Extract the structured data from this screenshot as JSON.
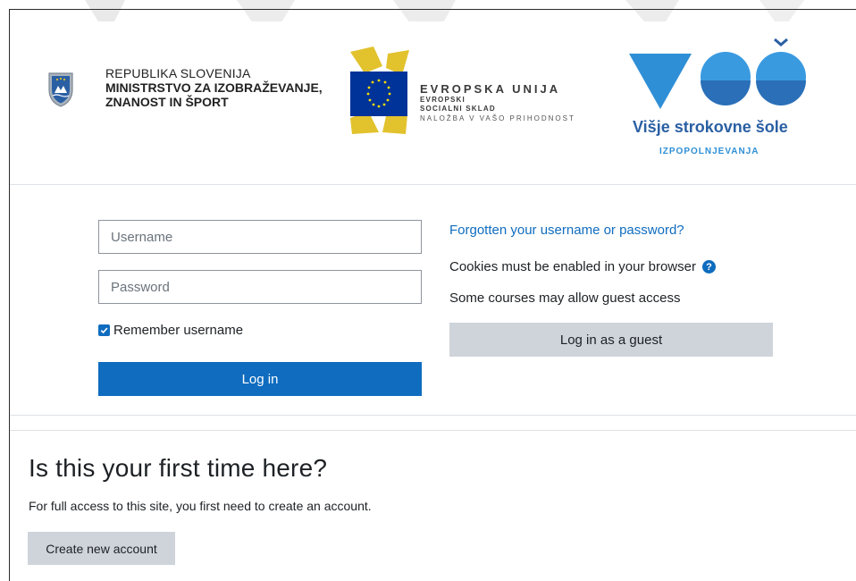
{
  "banner": {
    "slovenia": {
      "line1": "REPUBLIKA SLOVENIJA",
      "line2": "MINISTRSTVO ZA IZOBRAŽEVANJE,",
      "line3": "ZNANOST IN ŠPORT"
    },
    "eu": {
      "line1": "EVROPSKA UNIJA",
      "line2": "EVROPSKI",
      "line3": "SOCIALNI SKLAD",
      "line4": "NALOŽBA V VAŠO PRIHODNOST"
    },
    "voe": {
      "title": "Višje strokovne šole",
      "subtitle": "IZPOPOLNJEVANJA"
    }
  },
  "login": {
    "username_placeholder": "Username",
    "password_placeholder": "Password",
    "remember_label": "Remember username",
    "remember_checked": true,
    "login_button": "Log in",
    "forgot_link": "Forgotten your username or password?",
    "cookies_text": "Cookies must be enabled in your browser",
    "guest_text": "Some courses may allow guest access",
    "guest_button": "Log in as a guest"
  },
  "signup": {
    "heading": "Is this your first time here?",
    "text": "For full access to this site, you first need to create an account.",
    "button": "Create new account"
  },
  "colors": {
    "primary": "#0f6cbf",
    "secondary": "#ced4da",
    "eu_blue": "#003399",
    "eu_yellow": "#e2c22d",
    "voe_blue": "#2f8fd6"
  }
}
